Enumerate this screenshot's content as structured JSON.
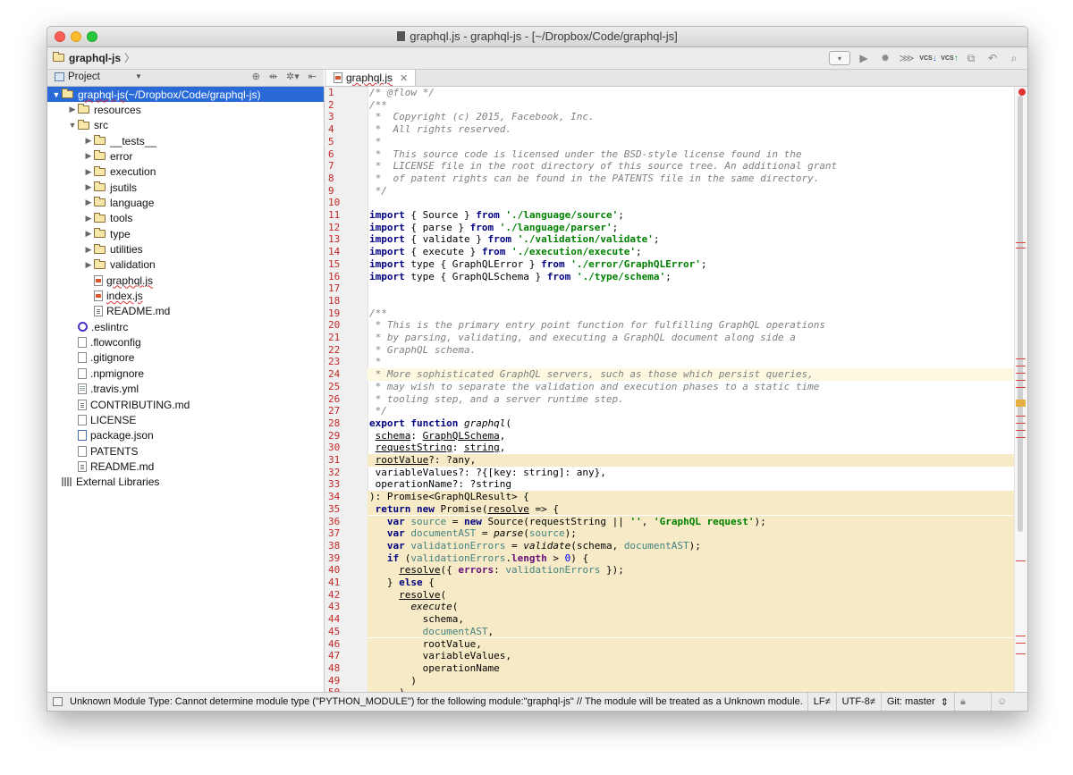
{
  "window": {
    "title": "graphql.js - graphql-js - [~/Dropbox/Code/graphql-js]"
  },
  "navbar": {
    "breadcrumb": "graphql-js",
    "vcs_label": "VCS"
  },
  "project_panel": {
    "title": "Project"
  },
  "tree": [
    {
      "label": "graphql-js",
      "suffix": " (~/Dropbox/Code/graphql-js)",
      "depth": 0,
      "type": "folder",
      "expanded": true,
      "selected": true
    },
    {
      "label": "resources",
      "depth": 1,
      "type": "folder",
      "expanded": false
    },
    {
      "label": "src",
      "depth": 1,
      "type": "folder",
      "expanded": true
    },
    {
      "label": "__tests__",
      "depth": 2,
      "type": "folder",
      "expanded": false
    },
    {
      "label": "error",
      "depth": 2,
      "type": "folder",
      "expanded": false
    },
    {
      "label": "execution",
      "depth": 2,
      "type": "folder",
      "expanded": false
    },
    {
      "label": "jsutils",
      "depth": 2,
      "type": "folder",
      "expanded": false
    },
    {
      "label": "language",
      "depth": 2,
      "type": "folder",
      "expanded": false
    },
    {
      "label": "tools",
      "depth": 2,
      "type": "folder",
      "expanded": false
    },
    {
      "label": "type",
      "depth": 2,
      "type": "folder",
      "expanded": false
    },
    {
      "label": "utilities",
      "depth": 2,
      "type": "folder",
      "expanded": false
    },
    {
      "label": "validation",
      "depth": 2,
      "type": "folder",
      "expanded": false
    },
    {
      "label": "graphql.js",
      "depth": 2,
      "type": "js"
    },
    {
      "label": "index.js",
      "depth": 2,
      "type": "js"
    },
    {
      "label": "README.md",
      "depth": 2,
      "type": "md"
    },
    {
      "label": ".eslintrc",
      "depth": 1,
      "type": "eslint"
    },
    {
      "label": ".flowconfig",
      "depth": 1,
      "type": "file"
    },
    {
      "label": ".gitignore",
      "depth": 1,
      "type": "file"
    },
    {
      "label": ".npmignore",
      "depth": 1,
      "type": "file"
    },
    {
      "label": ".travis.yml",
      "depth": 1,
      "type": "yml"
    },
    {
      "label": "CONTRIBUTING.md",
      "depth": 1,
      "type": "md"
    },
    {
      "label": "LICENSE",
      "depth": 1,
      "type": "file"
    },
    {
      "label": "package.json",
      "depth": 1,
      "type": "json"
    },
    {
      "label": "PATENTS",
      "depth": 1,
      "type": "file"
    },
    {
      "label": "README.md",
      "depth": 1,
      "type": "md"
    },
    {
      "label": "External Libraries",
      "depth": 0,
      "type": "libs"
    }
  ],
  "editor": {
    "tab_label": "graphql.js",
    "lines": [
      [
        [
          "c",
          "/* @flow */"
        ]
      ],
      [
        [
          "c",
          "/**"
        ]
      ],
      [
        [
          "c",
          " *  Copyright (c) 2015, Facebook, Inc."
        ]
      ],
      [
        [
          "c",
          " *  All rights reserved."
        ]
      ],
      [
        [
          "c",
          " *"
        ]
      ],
      [
        [
          "c",
          " *  This source code is licensed under the BSD-style license found in the"
        ]
      ],
      [
        [
          "c",
          " *  LICENSE file in the root directory of this source tree. An additional grant"
        ]
      ],
      [
        [
          "c",
          " *  of patent rights can be found in the PATENTS file in the same directory."
        ]
      ],
      [
        [
          "c",
          " */"
        ]
      ],
      [
        [
          "",
          ""
        ]
      ],
      [
        [
          "k",
          "import"
        ],
        [
          "",
          " { Source } "
        ],
        [
          "k",
          "from"
        ],
        [
          "",
          " "
        ],
        [
          "s",
          "'./language/source'"
        ],
        [
          "",
          ";"
        ]
      ],
      [
        [
          "k",
          "import"
        ],
        [
          "",
          " { parse } "
        ],
        [
          "k",
          "from"
        ],
        [
          "",
          " "
        ],
        [
          "s",
          "'./language/parser'"
        ],
        [
          "",
          ";"
        ]
      ],
      [
        [
          "k",
          "import"
        ],
        [
          "",
          " { validate } "
        ],
        [
          "k",
          "from"
        ],
        [
          "",
          " "
        ],
        [
          "s",
          "'./validation/validate'"
        ],
        [
          "",
          ";"
        ]
      ],
      [
        [
          "k",
          "import"
        ],
        [
          "",
          " { execute } "
        ],
        [
          "k",
          "from"
        ],
        [
          "",
          " "
        ],
        [
          "s",
          "'./execution/execute'"
        ],
        [
          "",
          ";"
        ]
      ],
      [
        [
          "k",
          "import"
        ],
        [
          "",
          " type { GraphQLError } "
        ],
        [
          "k",
          "from"
        ],
        [
          "",
          " "
        ],
        [
          "s",
          "'./error/GraphQLError'"
        ],
        [
          "",
          ";"
        ]
      ],
      [
        [
          "k",
          "import"
        ],
        [
          "",
          " type { GraphQLSchema } "
        ],
        [
          "k",
          "from"
        ],
        [
          "",
          " "
        ],
        [
          "s",
          "'./type/schema'"
        ],
        [
          "",
          ";"
        ]
      ],
      [
        [
          "",
          ""
        ]
      ],
      [
        [
          "",
          ""
        ]
      ],
      [
        [
          "c",
          "/**"
        ]
      ],
      [
        [
          "c",
          " * This is the primary entry point function for fulfilling GraphQL operations"
        ]
      ],
      [
        [
          "c",
          " * by parsing, validating, and executing a GraphQL document along side a"
        ]
      ],
      [
        [
          "c",
          " * GraphQL schema."
        ]
      ],
      [
        [
          "c",
          " *"
        ]
      ],
      [
        [
          "c",
          " * More sophisticated GraphQL servers, such as those which persist queries,"
        ]
      ],
      [
        [
          "c",
          " * may wish to separate the validation and execution phases to a static time"
        ]
      ],
      [
        [
          "c",
          " * tooling step, and a server runtime step."
        ]
      ],
      [
        [
          "c",
          " */"
        ]
      ],
      [
        [
          "k",
          "export function"
        ],
        [
          "",
          " "
        ],
        [
          "i",
          "graphql"
        ],
        [
          "",
          "("
        ]
      ],
      [
        [
          "",
          " "
        ],
        [
          "u",
          "schema"
        ],
        [
          "",
          ": "
        ],
        [
          "u",
          "GraphQLSchema"
        ],
        [
          "",
          ","
        ]
      ],
      [
        [
          "",
          " "
        ],
        [
          "u",
          "requestString"
        ],
        [
          "",
          ": "
        ],
        [
          "u",
          "string"
        ],
        [
          "",
          ","
        ]
      ],
      [
        [
          "",
          " "
        ],
        [
          "u",
          "rootValue"
        ],
        [
          "",
          "?: ?any,"
        ]
      ],
      [
        [
          "",
          " variableValues?: ?{[key: string]: any},"
        ]
      ],
      [
        [
          "",
          " operationName?: ?string"
        ]
      ],
      [
        [
          "",
          "): Promise<GraphQLResult> {"
        ]
      ],
      [
        [
          "",
          " "
        ],
        [
          "k",
          "return new"
        ],
        [
          "",
          " Promise("
        ],
        [
          "u",
          "resolve"
        ],
        [
          "",
          " => {"
        ]
      ],
      [
        [
          "",
          "   "
        ],
        [
          "k",
          "var"
        ],
        [
          "",
          " "
        ],
        [
          "v",
          "source"
        ],
        [
          "",
          " = "
        ],
        [
          "k",
          "new"
        ],
        [
          "",
          " Source(requestString || "
        ],
        [
          "s",
          "''"
        ],
        [
          "",
          ", "
        ],
        [
          "s",
          "'GraphQL request'"
        ],
        [
          "",
          ");"
        ]
      ],
      [
        [
          "",
          "   "
        ],
        [
          "k",
          "var"
        ],
        [
          "",
          " "
        ],
        [
          "v",
          "documentAST"
        ],
        [
          "",
          " = "
        ],
        [
          "i",
          "parse"
        ],
        [
          "",
          "("
        ],
        [
          "v",
          "source"
        ],
        [
          "",
          ");"
        ]
      ],
      [
        [
          "",
          "   "
        ],
        [
          "k",
          "var"
        ],
        [
          "",
          " "
        ],
        [
          "v",
          "validationErrors"
        ],
        [
          "",
          " = "
        ],
        [
          "i",
          "validate"
        ],
        [
          "",
          "(schema, "
        ],
        [
          "v",
          "documentAST"
        ],
        [
          "",
          ");"
        ]
      ],
      [
        [
          "",
          "   "
        ],
        [
          "k",
          "if"
        ],
        [
          "",
          " ("
        ],
        [
          "v",
          "validationErrors"
        ],
        [
          "",
          "."
        ],
        [
          "p",
          "length"
        ],
        [
          "",
          " > "
        ],
        [
          "n",
          "0"
        ],
        [
          "",
          ") {"
        ]
      ],
      [
        [
          "",
          "     "
        ],
        [
          "u",
          "resolve"
        ],
        [
          "",
          "({ "
        ],
        [
          "p",
          "errors"
        ],
        [
          "",
          ": "
        ],
        [
          "v",
          "validationErrors"
        ],
        [
          "",
          " });"
        ]
      ],
      [
        [
          "",
          "   } "
        ],
        [
          "k",
          "else"
        ],
        [
          "",
          " {"
        ]
      ],
      [
        [
          "",
          "     "
        ],
        [
          "u",
          "resolve"
        ],
        [
          "",
          "("
        ]
      ],
      [
        [
          "",
          "       "
        ],
        [
          "i",
          "execute"
        ],
        [
          "",
          "("
        ]
      ],
      [
        [
          "",
          "         schema,"
        ]
      ],
      [
        [
          "",
          "         "
        ],
        [
          "v",
          "documentAST"
        ],
        [
          "",
          ","
        ]
      ],
      [
        [
          "",
          "         rootValue,"
        ]
      ],
      [
        [
          "",
          "         variableValues,"
        ]
      ],
      [
        [
          "",
          "         operationName"
        ]
      ],
      [
        [
          "",
          "       )"
        ]
      ],
      [
        [
          "",
          "     )"
        ]
      ]
    ]
  },
  "status": {
    "message": "Unknown Module Type: Cannot determine module type (\"PYTHON_MODULE\") for the following module:\"graphql-js\" // The module will be treated as a Unknown module.",
    "line_sep": "LF≠",
    "encoding": "UTF-8≠",
    "branch": "Git: master"
  }
}
